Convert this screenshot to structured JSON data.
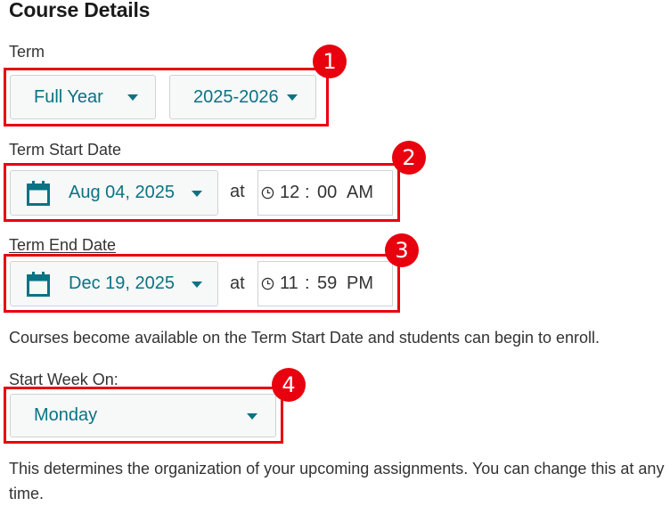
{
  "page": {
    "title": "Course Details"
  },
  "term": {
    "label": "Term",
    "period": "Full Year",
    "year": "2025-2026"
  },
  "start": {
    "label": "Term Start Date",
    "date": "Aug 04, 2025",
    "at": "at",
    "hour": "12",
    "sep": ":",
    "minute": "00",
    "ampm": "AM"
  },
  "end": {
    "label": "Term End Date",
    "date": "Dec 19, 2025",
    "at": "at",
    "hour": "11",
    "sep": ":",
    "minute": "59",
    "ampm": "PM"
  },
  "availability_note": "Courses become available on the Term Start Date and students can begin to enroll.",
  "week": {
    "label": "Start Week On:",
    "value": "Monday",
    "note": "This determines the organization of your upcoming assignments. You can change this at any time."
  },
  "annotations": [
    "1",
    "2",
    "3",
    "4"
  ],
  "colors": {
    "accent": "#0a7384",
    "highlight": "#e8000e",
    "text": "#333333"
  }
}
